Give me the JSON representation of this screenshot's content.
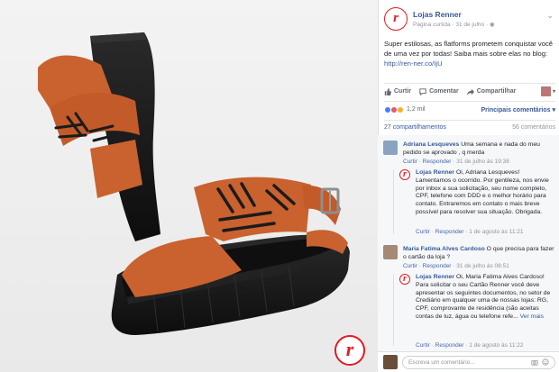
{
  "colors": {
    "brand_red": "#e31b23",
    "link_blue": "#365899",
    "meta_gray": "#90949c",
    "sandal_orange": "#c9622f",
    "sole_black": "#151515"
  },
  "photo": {
    "badge_letter": "r"
  },
  "post": {
    "logo_letter": "r",
    "page_name": "Lojas Renner",
    "meta_kind": "Página curtida",
    "meta_date": "31 de julho",
    "text": "Super estilosas, as flatforms prometem conquistar você de uma vez por todas! Saiba mais sobre elas no blog: ",
    "link": "http://ren-ner.co/IjU"
  },
  "actions": {
    "like": "Curtir",
    "comment": "Comentar",
    "share": "Compartilhar"
  },
  "reactions": {
    "count": "1,2 mil",
    "sort": "Principais comentários"
  },
  "shares": {
    "left": "27 compartilhamentos",
    "right": "56 comentários"
  },
  "comments": [
    {
      "author": "Adriana Lesqueves",
      "text": " Uma semana e nada do meu pedido se aprovado , q merda",
      "like": "Curtir",
      "reply": "Responder",
      "time": "31 de julho às 19:38",
      "reply_item": {
        "author": "Lojas Renner",
        "text": " Oi, Adriana Lesqueves! Lamentamos o ocorrido. Por gentileza, nos envie por inbox a sua solicitação, seu nome completo, CPF, telefone com DDD e o melhor horário para contato. Entraremos em contato o mais breve possível para resolver sua situação. Obrigada.",
        "like": "Curtir",
        "reply": "Responder",
        "time": "1 de agosto às 11:21"
      }
    },
    {
      "author": "Maria Fatima Alves Cardoso",
      "text": " O que precisa para fazer o cartão da loja ?",
      "like": "Curtir",
      "reply": "Responder",
      "time": "31 de julho às 08:51",
      "reply_item": {
        "author": "Lojas Renner",
        "text": " Oi, Maria Fatima Alves Cardoso! Para solicitar o seu Cartão Renner você deve apresentar os seguintes documentos, no setor de Crediário em qualquer uma de nossas lojas: RG, CPF, comprovante de residência (são aceitas contas de luz, água ou telefone refe...",
        "more": " Ver mais",
        "like": "Curtir",
        "reply": "Responder",
        "time": "1 de agosto às 11:22"
      }
    }
  ],
  "composer": {
    "placeholder": "Escreva um comentário..."
  }
}
